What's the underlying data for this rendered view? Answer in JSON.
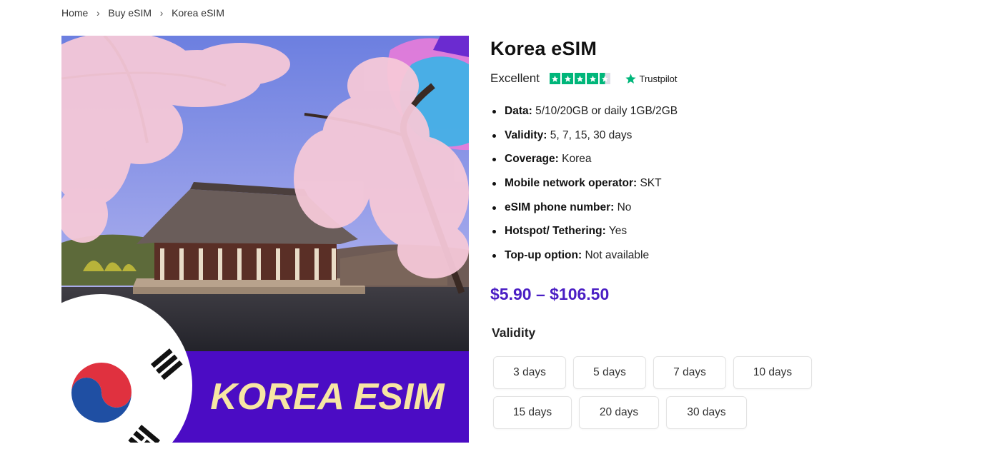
{
  "breadcrumb": {
    "items": [
      "Home",
      "Buy eSIM",
      "Korea eSIM"
    ]
  },
  "product": {
    "image_text": "KOREA ESIM",
    "title": "Korea eSIM",
    "rating": {
      "label": "Excellent",
      "stars": 4.5,
      "provider": "Trustpilot"
    },
    "features": [
      {
        "label": "Data:",
        "value": "5/10/20GB or daily 1GB/2GB"
      },
      {
        "label": "Validity:",
        "value": "5, 7, 15, 30 days"
      },
      {
        "label": "Coverage:",
        "value": "Korea"
      },
      {
        "label": "Mobile network operator:",
        "value": "SKT"
      },
      {
        "label": "eSIM phone number:",
        "value": "No"
      },
      {
        "label": "Hotspot/ Tethering:",
        "value": "Yes"
      },
      {
        "label": "Top-up option:",
        "value": "Not available"
      }
    ],
    "price": "$5.90 – $106.50",
    "validity_label": "Validity",
    "validity_options": [
      "3 days",
      "5 days",
      "7 days",
      "10 days",
      "15 days",
      "20 days",
      "30 days"
    ]
  },
  "colors": {
    "price": "#4a1ec4",
    "banner": "#4b0cc4",
    "trustpilot_green": "#00b67a",
    "banner_text": "#f7e6a4"
  }
}
